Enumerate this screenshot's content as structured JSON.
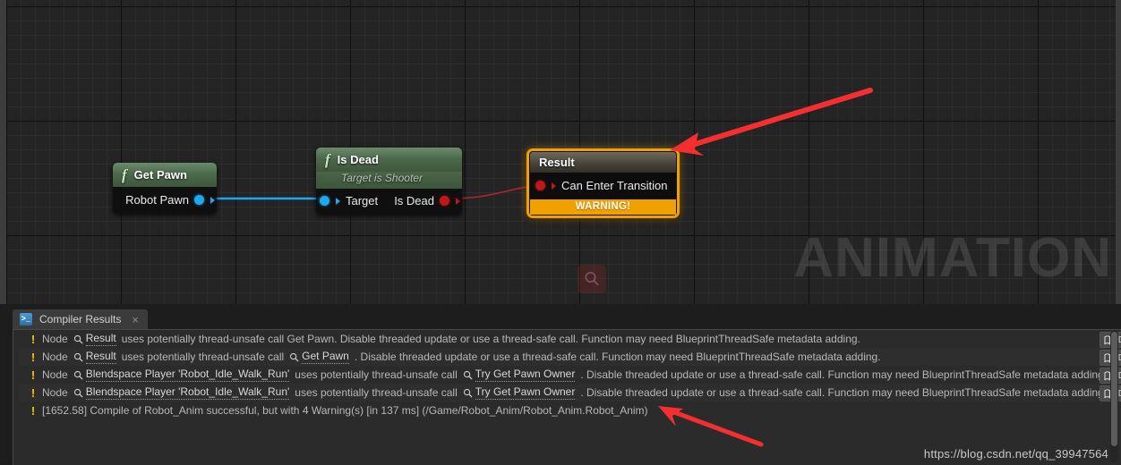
{
  "graph": {
    "watermark": "ANIMATION",
    "nodes": {
      "get_pawn": {
        "title": "Get Pawn",
        "fn_glyph": "f",
        "output_pin": "Robot Pawn",
        "pin_color": "#1fa7f0"
      },
      "is_dead": {
        "title": "Is Dead",
        "fn_glyph": "f",
        "subtitle": "Target is Shooter",
        "input_pin": "Target",
        "output_pin": "Is Dead",
        "input_pin_color": "#1fa7f0",
        "output_pin_color": "#c01818"
      },
      "result": {
        "title": "Result",
        "input_pin": "Can Enter Transition",
        "warning_label": "WARNING!",
        "accent_color": "#f0a000",
        "pin_color": "#c01818"
      }
    },
    "search_marker_icon": "search-icon",
    "annotation_color": "#f52f2f"
  },
  "panel": {
    "tab": {
      "label": "Compiler Results",
      "icon": ">_",
      "close": "×"
    },
    "doc_button_label": "D",
    "messages": [
      {
        "severity": "warning",
        "severity_icon": "!",
        "parts": [
          {
            "type": "text",
            "value": "Node"
          },
          {
            "type": "link",
            "value": "Result"
          },
          {
            "type": "text",
            "value": "uses potentially thread-unsafe call Get Pawn. Disable threaded update or use a thread-safe call. Function may need BlueprintThreadSafe metadata adding."
          }
        ]
      },
      {
        "severity": "warning",
        "severity_icon": "!",
        "parts": [
          {
            "type": "text",
            "value": "Node"
          },
          {
            "type": "link",
            "value": "Result"
          },
          {
            "type": "text",
            "value": "uses potentially thread-unsafe call"
          },
          {
            "type": "link",
            "value": "Get Pawn"
          },
          {
            "type": "text",
            "value": ". Disable threaded update or use a thread-safe call. Function may need BlueprintThreadSafe metadata adding."
          }
        ]
      },
      {
        "severity": "warning",
        "severity_icon": "!",
        "parts": [
          {
            "type": "text",
            "value": "Node"
          },
          {
            "type": "link",
            "value": "Blendspace Player 'Robot_Idle_Walk_Run'"
          },
          {
            "type": "text",
            "value": "uses potentially thread-unsafe call"
          },
          {
            "type": "link",
            "value": "Try Get Pawn Owner"
          },
          {
            "type": "text",
            "value": ". Disable threaded update or use a thread-safe call. Function may need BlueprintThreadSafe metadata adding."
          }
        ]
      },
      {
        "severity": "warning",
        "severity_icon": "!",
        "parts": [
          {
            "type": "text",
            "value": "Node"
          },
          {
            "type": "link",
            "value": "Blendspace Player 'Robot_Idle_Walk_Run'"
          },
          {
            "type": "text",
            "value": "uses potentially thread-unsafe call"
          },
          {
            "type": "link",
            "value": "Try Get Pawn Owner"
          },
          {
            "type": "text",
            "value": ". Disable threaded update or use a thread-safe call. Function may need BlueprintThreadSafe metadata adding."
          }
        ]
      },
      {
        "severity": "warning",
        "severity_icon": "!",
        "parts": [
          {
            "type": "text",
            "value": "[1652.58] Compile of Robot_Anim successful, but with 4 Warning(s) [in 137 ms] (/Game/Robot_Anim/Robot_Anim.Robot_Anim)"
          }
        ]
      }
    ]
  },
  "credit": {
    "url": "https://blog.csdn.net/qq_39947564"
  }
}
